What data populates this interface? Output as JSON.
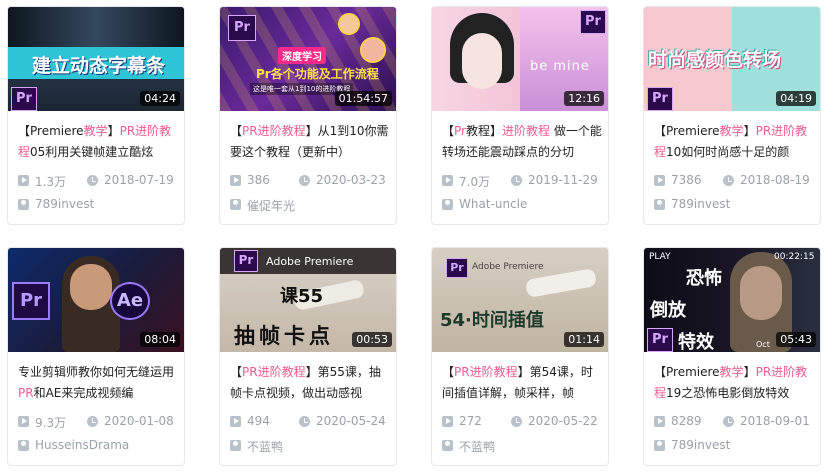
{
  "videos": [
    {
      "title_parts": [
        {
          "t": "【Premiere"
        },
        {
          "t": "教学",
          "hl": true
        },
        {
          "t": "】"
        },
        {
          "t": "PR进阶教程",
          "hl": true
        },
        {
          "t": "05利用关键帧建立酷炫"
        }
      ],
      "duration": "04:24",
      "views": "1.3万",
      "date": "2018-07-19",
      "uploader": "789invest",
      "thumb_text": "建立动态字幕条",
      "badge": "Pr"
    },
    {
      "title_parts": [
        {
          "t": "【"
        },
        {
          "t": "PR进阶教程",
          "hl": true
        },
        {
          "t": "】从1到10你需要这个教程（更新中）"
        }
      ],
      "duration": "01:54:57",
      "views": "386",
      "date": "2020-03-23",
      "uploader": "催促年光",
      "thumb_text": "Pr各个功能及工作流程",
      "thumb_sub": "深度学习",
      "thumb_note": "这是唯一套从1到10的进阶教程",
      "badge": "Pr"
    },
    {
      "title_parts": [
        {
          "t": "【"
        },
        {
          "t": "Pr",
          "hl": true
        },
        {
          "t": "教程】"
        },
        {
          "t": "进阶教程",
          "hl": true
        },
        {
          "t": " 做一个能转场还能震动踩点的分切"
        }
      ],
      "duration": "12:16",
      "views": "7.0万",
      "date": "2019-11-29",
      "uploader": "What-uncle",
      "thumb_text": "be mine",
      "badge": "Pr"
    },
    {
      "title_parts": [
        {
          "t": "【Premiere"
        },
        {
          "t": "教学",
          "hl": true
        },
        {
          "t": "】"
        },
        {
          "t": "PR进阶教程",
          "hl": true
        },
        {
          "t": "10如何时尚感十足的颜"
        }
      ],
      "duration": "04:19",
      "views": "7386",
      "date": "2018-08-19",
      "uploader": "789invest",
      "thumb_text": "时尚感颜色转场",
      "badge": "Pr"
    },
    {
      "title_parts": [
        {
          "t": "专业剪辑师教你如何无缝运用"
        },
        {
          "t": "PR",
          "hl": true
        },
        {
          "t": "和AE来完成视频编"
        }
      ],
      "duration": "08:04",
      "views": "9.3万",
      "date": "2020-01-08",
      "uploader": "HusseinsDrama",
      "badge": "Pr",
      "badge2": "Ae"
    },
    {
      "title_parts": [
        {
          "t": "【"
        },
        {
          "t": "PR进阶教程",
          "hl": true
        },
        {
          "t": "】第55课，抽帧卡点视频，做出动感视"
        }
      ],
      "duration": "00:53",
      "views": "494",
      "date": "2020-05-24",
      "uploader": "不蓝鸭",
      "thumb_text": "课55",
      "thumb_text2": "抽帧卡点",
      "thumb_brand": "Adobe Premiere",
      "badge": "Pr"
    },
    {
      "title_parts": [
        {
          "t": "【"
        },
        {
          "t": "PR进阶教程",
          "hl": true
        },
        {
          "t": "】第54课，时间插值详解，帧采样，帧"
        }
      ],
      "duration": "01:14",
      "views": "272",
      "date": "2020-05-22",
      "uploader": "不蓝鸭",
      "thumb_text": "54·时间插值",
      "thumb_brand": "Adobe Premiere",
      "badge": "Pr"
    },
    {
      "title_parts": [
        {
          "t": "【Premiere"
        },
        {
          "t": "教学",
          "hl": true
        },
        {
          "t": "】"
        },
        {
          "t": "PR进阶教程",
          "hl": true
        },
        {
          "t": "19之恐怖电影倒放特效"
        }
      ],
      "duration": "05:43",
      "views": "8289",
      "date": "2018-09-01",
      "uploader": "789invest",
      "thumb_text": "恐怖",
      "thumb_text2": "倒放",
      "thumb_text3": "特效",
      "thumb_play": "PLAY",
      "thumb_time": "00:22:15",
      "thumb_oct": "Oct",
      "badge": "Pr"
    }
  ],
  "colors": {
    "highlight": "#f25d8e",
    "meta": "#99a2aa",
    "title": "#222222"
  },
  "icons": {
    "views": "play-icon",
    "date": "clock-icon",
    "uploader": "user-icon"
  }
}
